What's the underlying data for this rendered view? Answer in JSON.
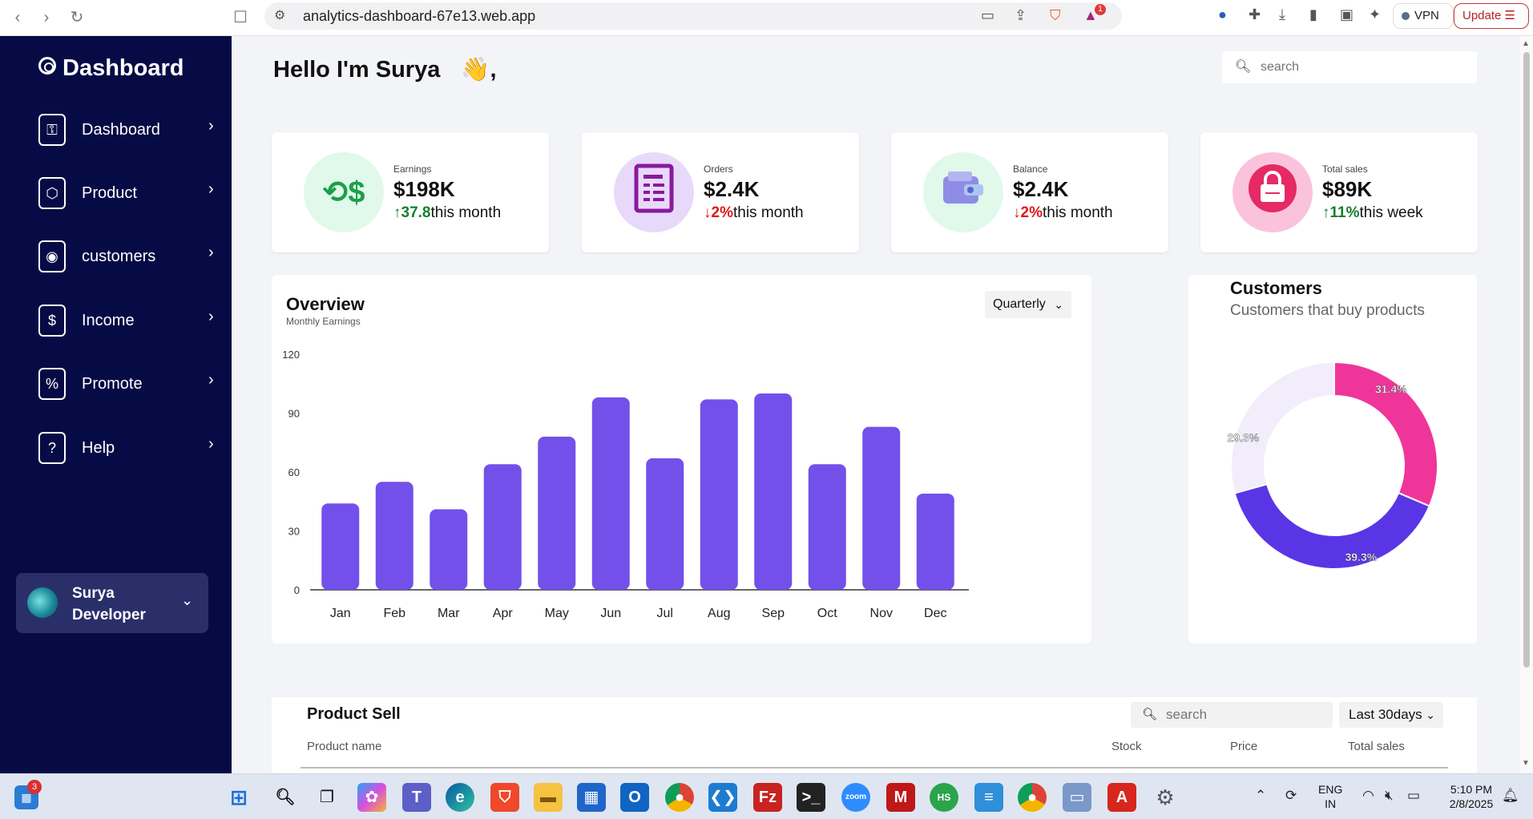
{
  "browser": {
    "url": "analytics-dashboard-67e13.web.app",
    "vpn_label": "VPN",
    "update_label": "Update",
    "notification_count": "1"
  },
  "sidebar": {
    "brand": "Dashboard",
    "items": [
      {
        "label": "Dashboard",
        "icon": "key-icon"
      },
      {
        "label": "Product",
        "icon": "cube-icon"
      },
      {
        "label": "customers",
        "icon": "user-circle-icon"
      },
      {
        "label": "Income",
        "icon": "dollar-icon"
      },
      {
        "label": "Promote",
        "icon": "percent-icon"
      },
      {
        "label": "Help",
        "icon": "help-icon"
      }
    ],
    "profile": {
      "name": "Surya",
      "role": "Developer"
    }
  },
  "header": {
    "greeting": "Hello I'm Surya",
    "wave": "👋",
    "comma": ",",
    "search_placeholder": "search"
  },
  "cards": [
    {
      "label": "Earnings",
      "value": "$198K",
      "delta": "37.8",
      "suffix": "this month",
      "direction": "up",
      "circle_bg": "#e0f9ea",
      "icon_color": "#1e9e4a"
    },
    {
      "label": "Orders",
      "value": "$2.4K",
      "delta": "2%",
      "suffix": "this month",
      "direction": "down",
      "circle_bg": "#e8d9fb",
      "icon_color": "#8a1a9c"
    },
    {
      "label": "Balance",
      "value": "$2.4K",
      "delta": "2%",
      "suffix": "this month",
      "direction": "down",
      "circle_bg": "#e0f9ea",
      "icon_color": "#3a7bd5"
    },
    {
      "label": "Total sales",
      "value": "$89K",
      "delta": "11%",
      "suffix": "this week",
      "direction": "up",
      "circle_bg": "#fbc3db",
      "icon_color": "#e52a66"
    }
  ],
  "overview": {
    "title": "Overview",
    "subtitle": "Monthly Earnings",
    "period": "Quarterly"
  },
  "chart_data": [
    {
      "type": "bar",
      "title": "Overview",
      "subtitle": "Monthly Earnings",
      "categories": [
        "Jan",
        "Feb",
        "Mar",
        "Apr",
        "May",
        "Jun",
        "Jul",
        "Aug",
        "Sep",
        "Oct",
        "Nov",
        "Dec"
      ],
      "values": [
        44,
        55,
        41,
        64,
        78,
        98,
        67,
        97,
        100,
        64,
        83,
        49
      ],
      "ylim": [
        0,
        120
      ],
      "yticks": [
        0,
        30,
        60,
        90,
        120
      ],
      "color": "#7350ea",
      "grid": false
    },
    {
      "type": "pie",
      "title": "Customers",
      "subtitle": "Customers that buy products",
      "slices": [
        {
          "label": "31.4%",
          "value": 31.4,
          "color": "#f0359a"
        },
        {
          "label": "39.3%",
          "value": 39.3,
          "color": "#5a35e6"
        },
        {
          "label": "29.3%",
          "value": 29.3,
          "color": "#f1edfb"
        }
      ]
    }
  ],
  "customers": {
    "title": "Customers",
    "subtitle": "Customers that buy products"
  },
  "product_sell": {
    "title": "Product Sell",
    "search_placeholder": "search",
    "range": "Last 30days",
    "columns": [
      "Product name",
      "Stock",
      "Price",
      "Total sales"
    ]
  },
  "taskbar": {
    "widgets_badge": "3",
    "language": "ENG",
    "region": "IN",
    "time": "5:10 PM",
    "date": "2/8/2025"
  }
}
